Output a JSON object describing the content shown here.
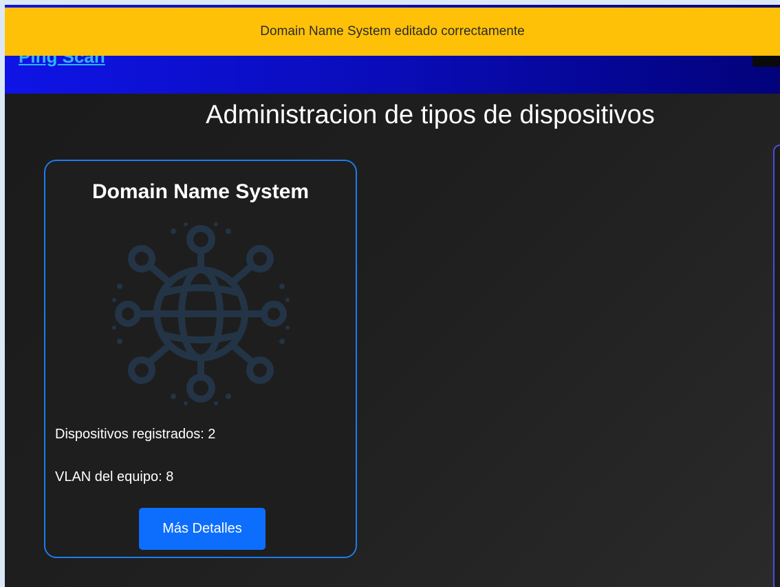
{
  "navbar": {
    "brand": "Ping Scan"
  },
  "toast": {
    "message": "Domain Name System editado correctamente",
    "color": "#ffc107"
  },
  "page": {
    "title": "Administracion de tipos de dispositivos"
  },
  "card": {
    "title": "Domain Name System",
    "icon": "globe-network-icon",
    "devices_label": "Dispositivos registrados: 2",
    "vlan_label": "VLAN del equipo: 8",
    "button_label": "Más Detalles",
    "border_color": "#1e7bf0",
    "button_color": "#0d6efd"
  }
}
